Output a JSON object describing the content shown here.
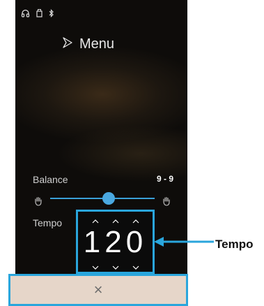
{
  "status_bar": {
    "icons": [
      "headphones-icon",
      "usb-icon",
      "bluetooth-icon"
    ]
  },
  "menu": {
    "label": "Menu",
    "icon": "play-outline-icon"
  },
  "balance": {
    "label": "Balance",
    "value": "9 - 9",
    "left_icon": "hand-icon",
    "right_icon": "hand-icon",
    "level": 0.5
  },
  "tempo": {
    "label": "Tempo",
    "value": "120"
  },
  "close": {
    "glyph": "×"
  },
  "callout": {
    "label": "Tempo"
  },
  "colors": {
    "accent": "#2aa6dc",
    "slider": "#3aa0d8",
    "bottom_bar": "#e6d6c9"
  }
}
